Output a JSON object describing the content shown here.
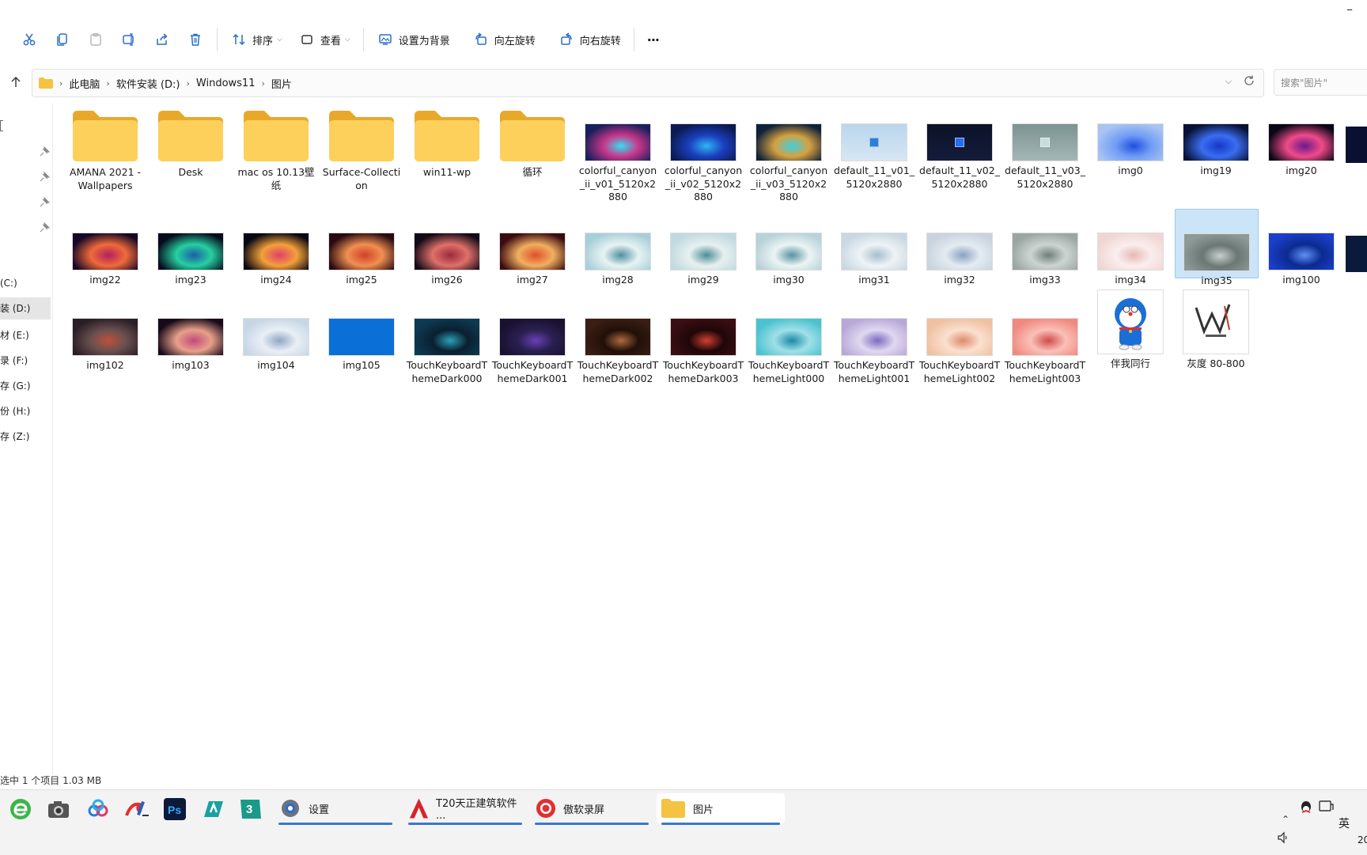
{
  "window": {
    "minimize_glyph": "–"
  },
  "toolbar": {
    "sort_label": "排序",
    "view_label": "查看",
    "set_bg_label": "设置为背景",
    "rotate_left_label": "向左旋转",
    "rotate_right_label": "向右旋转",
    "more_label": "···"
  },
  "address": {
    "crumbs": [
      "此电脑",
      "软件安装 (D:)",
      "Windows11",
      "图片"
    ],
    "search_placeholder": "搜索\"图片\""
  },
  "sidebar": {
    "drives": [
      {
        "label": "(C:)"
      },
      {
        "label": "装 (D:)"
      },
      {
        "label": "材 (E:)"
      },
      {
        "label": "录 (F:)"
      },
      {
        "label": "存 (G:)"
      },
      {
        "label": "份 (H:)"
      },
      {
        "label": "存 (Z:)"
      }
    ]
  },
  "files": [
    {
      "name": "AMANA 2021 - Wallpapers",
      "kind": "folder"
    },
    {
      "name": "Desk",
      "kind": "folder"
    },
    {
      "name": "mac os 10.13壁纸",
      "kind": "folder"
    },
    {
      "name": "Surface-Collection",
      "kind": "folder"
    },
    {
      "name": "win11-wp",
      "kind": "folder"
    },
    {
      "name": "循环",
      "kind": "folder"
    },
    {
      "name": "colorful_canyon_ii_v01_5120x2880",
      "kind": "image",
      "colors": [
        "#1b1f5c",
        "#36e0f0",
        "#c8368a"
      ]
    },
    {
      "name": "colorful_canyon_ii_v02_5120x2880",
      "kind": "image",
      "colors": [
        "#0b1a52",
        "#2fb6f3",
        "#1b3fbf"
      ]
    },
    {
      "name": "colorful_canyon_ii_v03_5120x2880",
      "kind": "image",
      "colors": [
        "#10223a",
        "#3ed0e0",
        "#d6a040"
      ]
    },
    {
      "name": "default_11_v01_5120x2880",
      "kind": "image",
      "colors": [
        "#b9d6ee",
        "#d7e6f3",
        "#2b7fd6"
      ]
    },
    {
      "name": "default_11_v02_5120x2880",
      "kind": "image",
      "colors": [
        "#0c1228",
        "#141c3a",
        "#2a6cf0"
      ]
    },
    {
      "name": "default_11_v03_5120x2880",
      "kind": "image",
      "colors": [
        "#7c9392",
        "#a4b7b6",
        "#c8dede"
      ]
    },
    {
      "name": "img0",
      "kind": "image",
      "colors": [
        "#a9c4f1",
        "#1f4fe0",
        "#6f9cf5"
      ]
    },
    {
      "name": "img19",
      "kind": "image",
      "colors": [
        "#071236",
        "#1537c9",
        "#3a6df0"
      ]
    },
    {
      "name": "img20",
      "kind": "image",
      "colors": [
        "#0a0616",
        "#6a1a8a",
        "#f04a8a"
      ]
    },
    {
      "name": "img22",
      "kind": "image",
      "colors": [
        "#160826",
        "#b0205c",
        "#f06a3a"
      ]
    },
    {
      "name": "img23",
      "kind": "image",
      "colors": [
        "#070b1e",
        "#1b5ea8",
        "#26d0a0"
      ]
    },
    {
      "name": "img24",
      "kind": "image",
      "colors": [
        "#090713",
        "#e0406a",
        "#f3a03a"
      ]
    },
    {
      "name": "img25",
      "kind": "image",
      "colors": [
        "#2a0a12",
        "#d0402a",
        "#f09050"
      ]
    },
    {
      "name": "img26",
      "kind": "image",
      "colors": [
        "#120a16",
        "#9a2a3a",
        "#e0706a"
      ]
    },
    {
      "name": "img27",
      "kind": "image",
      "colors": [
        "#3a0a10",
        "#e0502a",
        "#f0b060"
      ]
    },
    {
      "name": "img28",
      "kind": "image",
      "colors": [
        "#a8cfd8",
        "#4e8fa0",
        "#e8f3f3"
      ]
    },
    {
      "name": "img29",
      "kind": "image",
      "colors": [
        "#c0dae0",
        "#4a8e98",
        "#e8f0ef"
      ]
    },
    {
      "name": "img30",
      "kind": "image",
      "colors": [
        "#b7d2d8",
        "#56939f",
        "#ecf4f4"
      ]
    },
    {
      "name": "img31",
      "kind": "image",
      "colors": [
        "#c9d8e2",
        "#a6bfcd",
        "#eef3f6"
      ]
    },
    {
      "name": "img32",
      "kind": "image",
      "colors": [
        "#c8d3dd",
        "#8aa2c0",
        "#e4ebf2"
      ]
    },
    {
      "name": "img33",
      "kind": "image",
      "colors": [
        "#9aa6a2",
        "#6f7f7a",
        "#cdd5d1"
      ]
    },
    {
      "name": "img34",
      "kind": "image",
      "colors": [
        "#f0d6d3",
        "#e8b7b4",
        "#faeeee"
      ]
    },
    {
      "name": "img35",
      "kind": "image",
      "colors": [
        "#8e9a97",
        "#c7d0cd",
        "#6b7774"
      ]
    },
    {
      "name": "img100",
      "kind": "image",
      "colors": [
        "#1a3fc8",
        "#5f90f5",
        "#0c2a90"
      ]
    },
    {
      "name": "img102",
      "kind": "image",
      "colors": [
        "#2a1e26",
        "#c0503a",
        "#6a5050"
      ]
    },
    {
      "name": "img103",
      "kind": "image",
      "colors": [
        "#180a1a",
        "#c04a7a",
        "#e8a08a"
      ]
    },
    {
      "name": "img104",
      "kind": "image",
      "colors": [
        "#c6d6e6",
        "#8fa6c4",
        "#e9eff5"
      ]
    },
    {
      "name": "img105",
      "kind": "image",
      "colors": [
        "#0a6fd6",
        "#0a6fd6",
        "#0a6fd6"
      ]
    },
    {
      "name": "TouchKeyboardThemeDark000",
      "kind": "image",
      "colors": [
        "#0d3a52",
        "#2aa0b8",
        "#0a2030"
      ]
    },
    {
      "name": "TouchKeyboardThemeDark001",
      "kind": "image",
      "colors": [
        "#1a1030",
        "#6a40b8",
        "#2a2050"
      ]
    },
    {
      "name": "TouchKeyboardThemeDark002",
      "kind": "image",
      "colors": [
        "#3a1e14",
        "#b06a40",
        "#201008"
      ]
    },
    {
      "name": "TouchKeyboardThemeDark003",
      "kind": "image",
      "colors": [
        "#3a0e12",
        "#d04030",
        "#200608"
      ]
    },
    {
      "name": "TouchKeyboardThemeLight000",
      "kind": "image",
      "colors": [
        "#4ac2d0",
        "#1a8aa8",
        "#a0e0e8"
      ]
    },
    {
      "name": "TouchKeyboardThemeLight001",
      "kind": "image",
      "colors": [
        "#b8a8d8",
        "#7a6ac0",
        "#e0d8f0"
      ]
    },
    {
      "name": "TouchKeyboardThemeLight002",
      "kind": "image",
      "colors": [
        "#f0c0a0",
        "#e08a6a",
        "#fae0d0"
      ]
    },
    {
      "name": "TouchKeyboardThemeLight003",
      "kind": "image",
      "colors": [
        "#f08a80",
        "#d04a4a",
        "#fac0b8"
      ]
    },
    {
      "name": "伴我同行",
      "kind": "doraemon"
    },
    {
      "name": "灰度 80-800",
      "kind": "logo"
    }
  ],
  "status": {
    "text": "选中 1 个项目  1.03 MB"
  },
  "taskbar": {
    "apps": [
      {
        "label": "设置"
      },
      {
        "label": "T20天正建筑软件 ..."
      },
      {
        "label": "傲软录屏"
      },
      {
        "label": "图片"
      }
    ],
    "ime": "英",
    "clock_fragment": "20"
  }
}
